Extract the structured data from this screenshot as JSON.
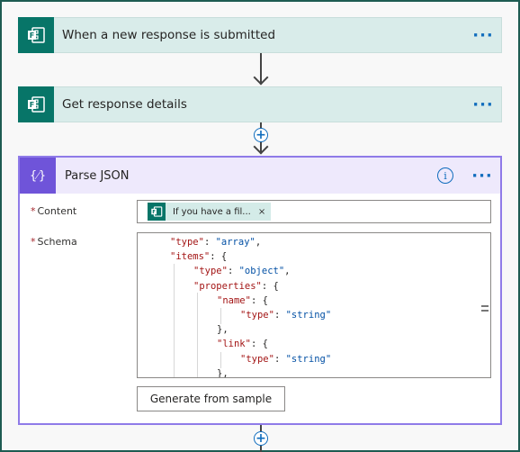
{
  "cards": {
    "trigger": {
      "title": "When a new response is submitted",
      "more": "···"
    },
    "details": {
      "title": "Get response details",
      "more": "···"
    }
  },
  "parse": {
    "icon_text": "{⁄}",
    "title": "Parse JSON",
    "info": "i",
    "more": "···",
    "content_label": "Content",
    "schema_label": "Schema",
    "required_mark": "*",
    "token_text": "If you have a fil...",
    "token_remove": "×",
    "generate_label": "Generate from sample"
  },
  "add_step": "+",
  "schema_lines": [
    {
      "k": "\"type\"",
      "sep": ": ",
      "v": "\"array\"",
      "end": ","
    },
    {
      "k": "\"items\"",
      "sep": ": ",
      "v": "",
      "end": "{"
    },
    {
      "k": "\"type\"",
      "sep": ": ",
      "v": "\"object\"",
      "end": ","
    },
    {
      "k": "\"properties\"",
      "sep": ": ",
      "v": "",
      "end": "{"
    },
    {
      "k": "\"name\"",
      "sep": ": ",
      "v": "",
      "end": "{"
    },
    {
      "k": "\"type\"",
      "sep": ": ",
      "v": "\"string\"",
      "end": ""
    },
    {
      "k": "",
      "sep": "",
      "v": "",
      "end": "},"
    },
    {
      "k": "\"link\"",
      "sep": ": ",
      "v": "",
      "end": "{"
    },
    {
      "k": "\"type\"",
      "sep": ": ",
      "v": "\"string\"",
      "end": ""
    },
    {
      "k": "",
      "sep": "",
      "v": "",
      "end": "},"
    }
  ]
}
